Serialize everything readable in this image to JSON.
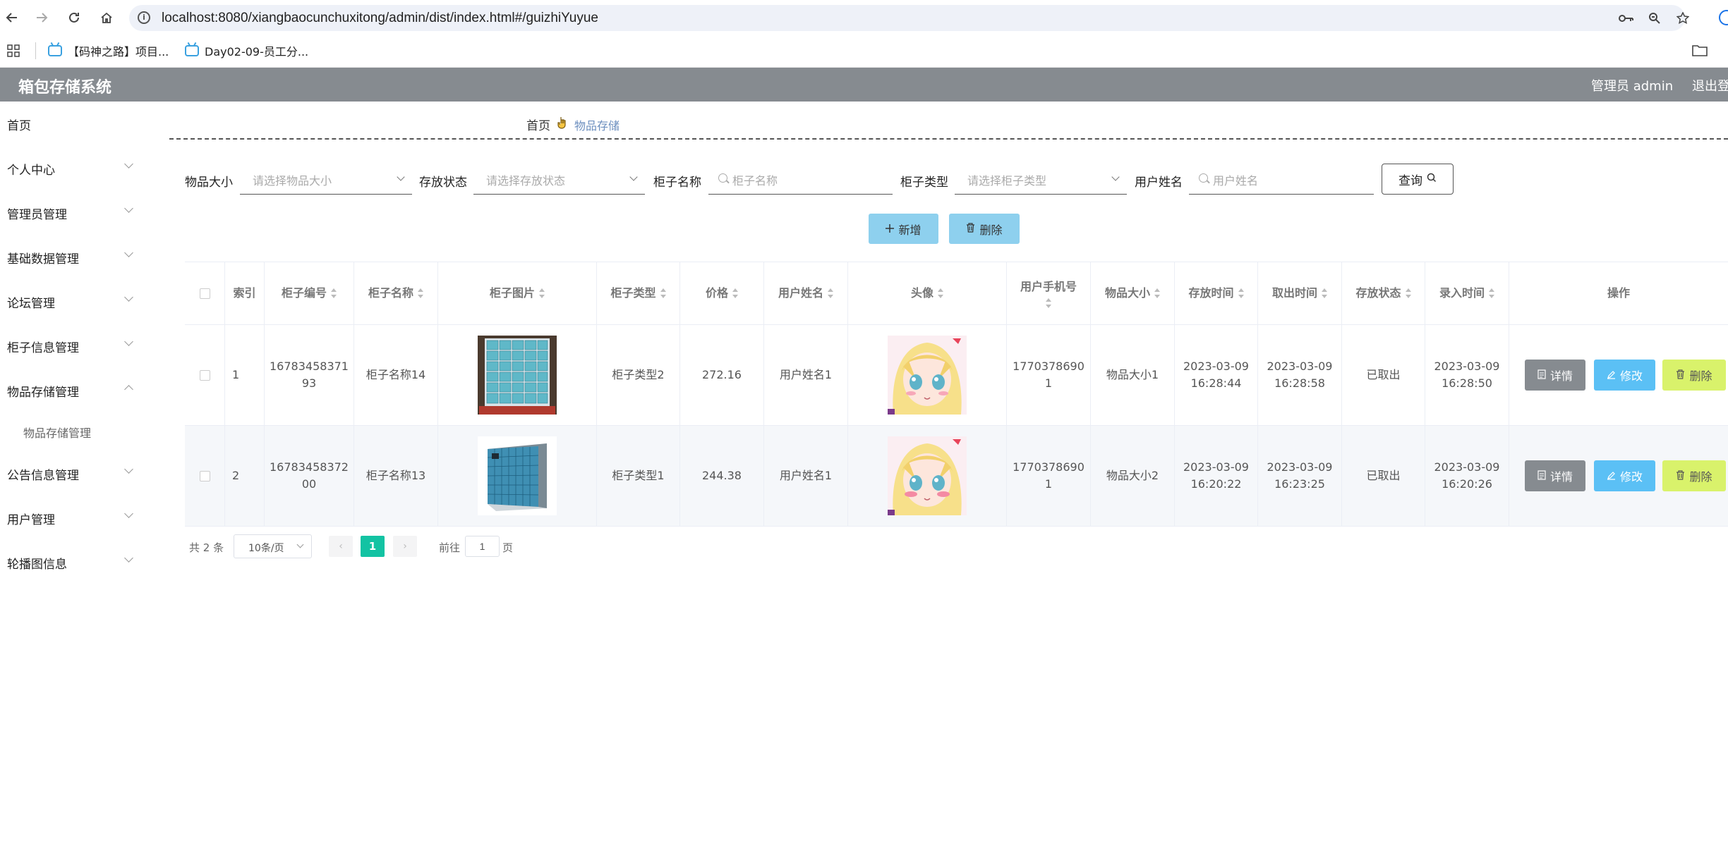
{
  "browser": {
    "url": "localhost:8080/xiangbaocunchuxitong/admin/dist/index.html#/guizhiYuyue",
    "bookmarks": [
      {
        "label": "【码神之路】项目..."
      },
      {
        "label": "Day02-09-员工分..."
      }
    ]
  },
  "header": {
    "title": "箱包存储系统",
    "admin": "管理员 admin",
    "logout": "退出登"
  },
  "sidebar": {
    "items": [
      {
        "label": "首页"
      },
      {
        "label": "个人中心"
      },
      {
        "label": "管理员管理"
      },
      {
        "label": "基础数据管理"
      },
      {
        "label": "论坛管理"
      },
      {
        "label": "柜子信息管理"
      },
      {
        "label": "物品存储管理"
      },
      {
        "label": "公告信息管理"
      },
      {
        "label": "用户管理"
      },
      {
        "label": "轮播图信息"
      }
    ],
    "sub_item": "物品存储管理"
  },
  "breadcrumb": {
    "home": "首页",
    "current": "物品存储"
  },
  "filters": {
    "size_label": "物品大小",
    "size_placeholder": "请选择物品大小",
    "status_label": "存放状态",
    "status_placeholder": "请选择存放状态",
    "cabinet_name_label": "柜子名称",
    "cabinet_name_placeholder": "柜子名称",
    "cabinet_type_label": "柜子类型",
    "cabinet_type_placeholder": "请选择柜子类型",
    "user_name_label": "用户姓名",
    "user_name_placeholder": "用户姓名",
    "query_label": "查询"
  },
  "actions": {
    "add_label": "新增",
    "delete_label": "删除"
  },
  "table": {
    "headers": {
      "index": "索引",
      "cabinet_no": "柜子编号",
      "cabinet_name": "柜子名称",
      "cabinet_image": "柜子图片",
      "cabinet_type": "柜子类型",
      "price": "价格",
      "user_name": "用户姓名",
      "avatar": "头像",
      "phone": "用户手机号",
      "item_size": "物品大小",
      "store_time": "存放时间",
      "take_time": "取出时间",
      "status": "存放状态",
      "entry_time": "录入时间",
      "ops": "操作"
    },
    "rows": [
      {
        "index": "1",
        "cabinet_no_1": "16783458371",
        "cabinet_no_2": "93",
        "cabinet_name": "柜子名称14",
        "cabinet_type": "柜子类型2",
        "price": "272.16",
        "user_name": "用户姓名1",
        "phone_1": "1770378690",
        "phone_2": "1",
        "item_size": "物品大小1",
        "store_date": "2023-03-09",
        "store_clock": "16:28:44",
        "take_date": "2023-03-09",
        "take_clock": "16:28:58",
        "status": "已取出",
        "entry_date": "2023-03-09",
        "entry_clock": "16:28:50"
      },
      {
        "index": "2",
        "cabinet_no_1": "16783458372",
        "cabinet_no_2": "00",
        "cabinet_name": "柜子名称13",
        "cabinet_type": "柜子类型1",
        "price": "244.38",
        "user_name": "用户姓名1",
        "phone_1": "1770378690",
        "phone_2": "1",
        "item_size": "物品大小2",
        "store_date": "2023-03-09",
        "store_clock": "16:20:22",
        "take_date": "2023-03-09",
        "take_clock": "16:23:25",
        "status": "已取出",
        "entry_date": "2023-03-09",
        "entry_clock": "16:20:26"
      }
    ],
    "op_detail": "详情",
    "op_edit": "修改",
    "op_delete": "删除"
  },
  "pagination": {
    "total": "共 2 条",
    "page_size": "10条/页",
    "current": "1",
    "goto_prefix": "前往",
    "goto_value": "1",
    "goto_suffix": "页"
  },
  "colors": {
    "header_bg": "#868b90",
    "action_blue": "#8ed0ee",
    "edit_blue": "#5bc0f5",
    "delete_green": "#d9f26b",
    "page_active": "#13c3a3"
  }
}
